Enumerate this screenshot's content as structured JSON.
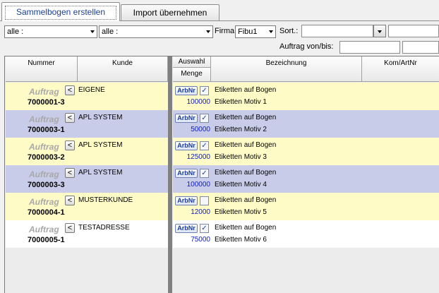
{
  "tabs": [
    {
      "label": "Sammelbogen erstellen",
      "active": true
    },
    {
      "label": "Import übernehmen",
      "active": false
    }
  ],
  "filters": {
    "select1": "alle :",
    "select2": "alle :",
    "firma_label": "Firma:",
    "firma_value": "Fibu1",
    "sort_label": "Sort.:",
    "sort_value": "",
    "auftrag_label": "Auftrag von/bis:",
    "auftrag_von": "",
    "auftrag_bis": ""
  },
  "columns": {
    "nummer": "Nummer",
    "kunde": "Kunde",
    "auswahl": "Auswahl",
    "menge": "Menge",
    "bezeichnung": "Bezeichnung",
    "komartnr": "Kom/ArtNr"
  },
  "row_labels": {
    "auftrag": "Auftrag",
    "back": "<",
    "arbnr": "ArbNr",
    "check": "✓"
  },
  "rows": [
    {
      "kunde": "EIGENE",
      "nummer": "7000001-3",
      "checked": true,
      "menge": "100000",
      "bez1": "Etiketten auf Bogen",
      "bez2": "Etiketten Motiv 1",
      "color": "yellow"
    },
    {
      "kunde": "APL SYSTEM",
      "nummer": "7000003-1",
      "checked": true,
      "menge": "50000",
      "bez1": "Etiketten auf Bogen",
      "bez2": "Etiketten Motiv 2",
      "color": "blue"
    },
    {
      "kunde": "APL SYSTEM",
      "nummer": "7000003-2",
      "checked": true,
      "menge": "125000",
      "bez1": "Etiketten auf Bogen",
      "bez2": "Etiketten Motiv 3",
      "color": "yellow"
    },
    {
      "kunde": "APL SYSTEM",
      "nummer": "7000003-3",
      "checked": true,
      "menge": "100000",
      "bez1": "Etiketten auf Bogen",
      "bez2": "Etiketten Motiv 4",
      "color": "blue"
    },
    {
      "kunde": "MUSTERKUNDE",
      "nummer": "7000004-1",
      "checked": false,
      "menge": "12000",
      "bez1": "Etiketten auf Bogen",
      "bez2": "Etiketten Motiv 5",
      "color": "yellow"
    },
    {
      "kunde": "TESTADRESSE",
      "nummer": "7000005-1",
      "checked": true,
      "menge": "75000",
      "bez1": "Etiketten auf Bogen",
      "bez2": "Etiketten Motiv 6",
      "color": "white"
    }
  ]
}
